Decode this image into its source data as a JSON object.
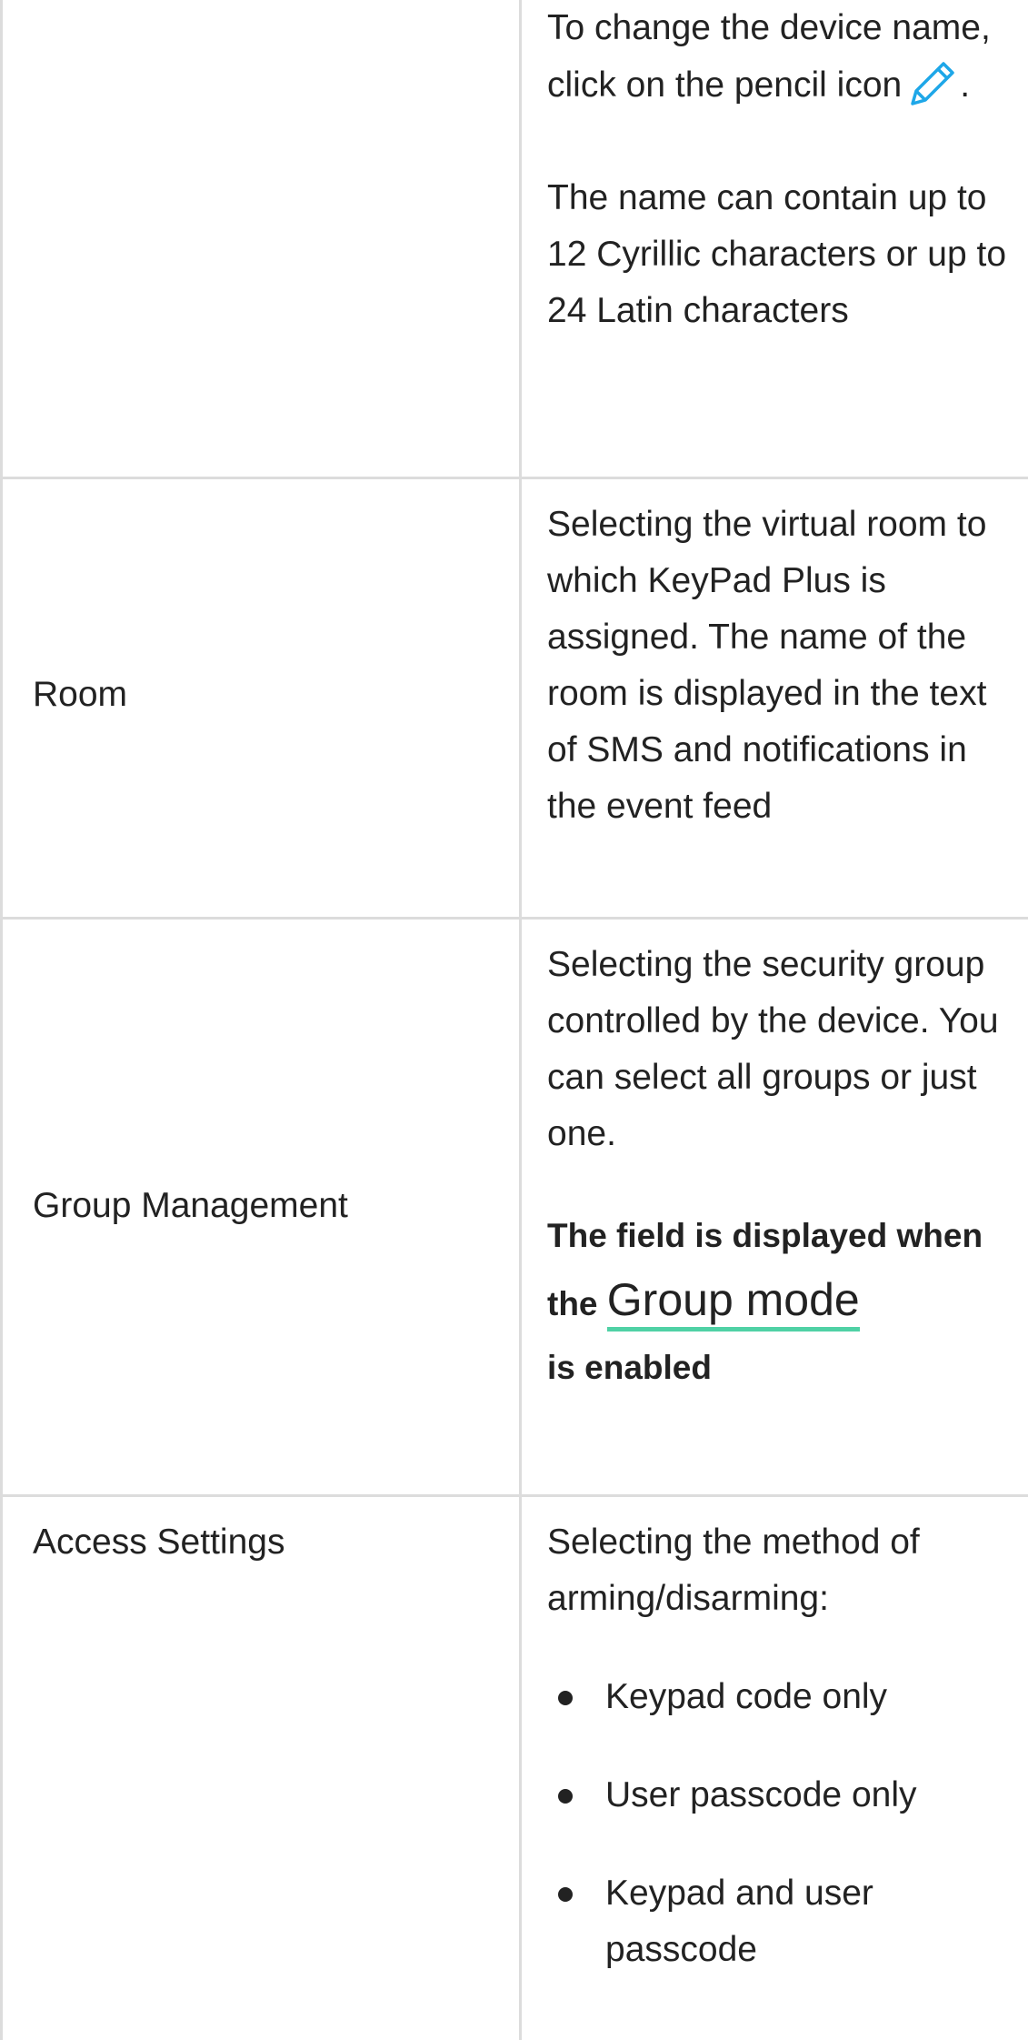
{
  "rows": [
    {
      "label": "",
      "desc": {
        "line1": "To change the device name, click on the pencil icon",
        "line1_suffix": ".",
        "pencil_icon": "pencil-icon",
        "pencil_color": "#1ea7e8",
        "para2": "The name can contain up to 12 Cyrillic characters or up to 24 Latin characters"
      }
    },
    {
      "label": "Room",
      "desc": {
        "para1": "Selecting the virtual room to which KeyPad Plus is assigned. The name of the room is displayed in the text of SMS and notifications in the event feed"
      }
    },
    {
      "label": "Group Management",
      "desc": {
        "para1": "Selecting the security group controlled by the device. You can select all groups or just one.",
        "note_prefix": "The field is displayed when the",
        "note_link": "Group mode",
        "note_suffix": "is enabled",
        "link_underline_color": "#4fd1a5"
      }
    },
    {
      "label": "Access Settings",
      "desc": {
        "para1": "Selecting the method of arming/disarming:",
        "options": [
          "Keypad code only",
          "User passcode only",
          "Keypad and user passcode"
        ]
      }
    }
  ]
}
